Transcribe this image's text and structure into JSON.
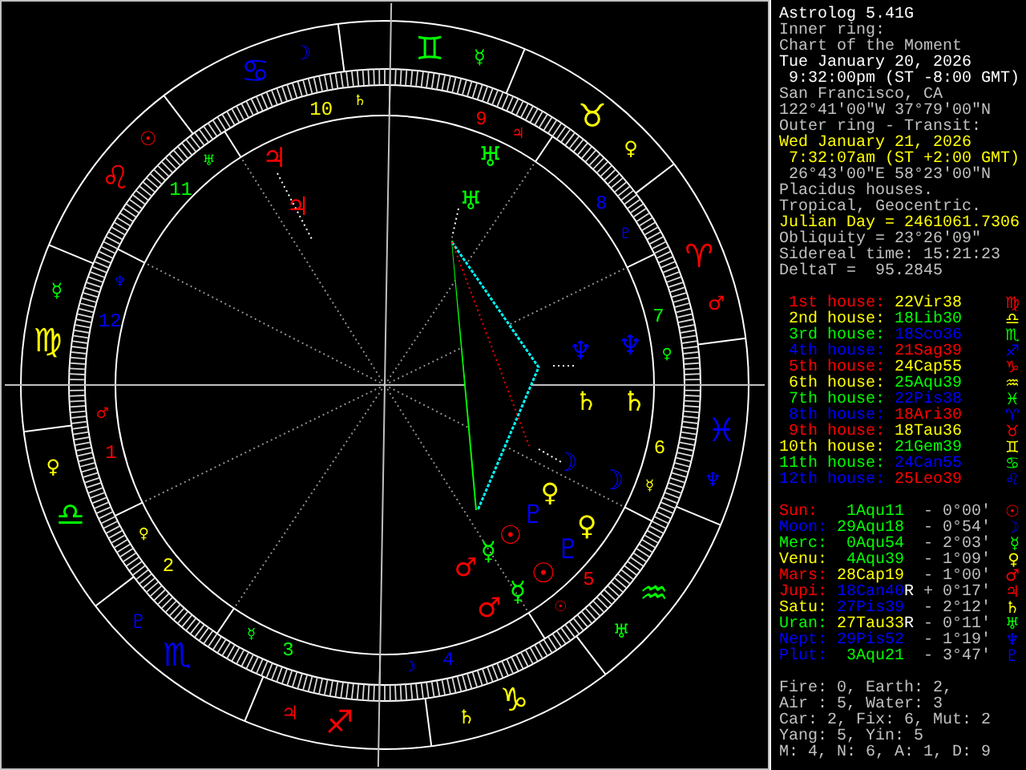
{
  "info": [
    {
      "text": "Astrolog 5.41G",
      "color": "#ffffff"
    },
    {
      "text": "Inner ring:",
      "color": "#c0c0c0"
    },
    {
      "text": "Chart of the Moment",
      "color": "#c0c0c0"
    },
    {
      "text": "Tue January 20, 2026",
      "color": "#ffffff"
    },
    {
      "text": " 9:32:00pm (ST -8:00 GMT)",
      "color": "#ffffff"
    },
    {
      "text": "San Francisco, CA",
      "color": "#c0c0c0"
    },
    {
      "text": "122°41'00\"W 37°79'00\"N",
      "color": "#c0c0c0"
    },
    {
      "text": "Outer ring - Transit:",
      "color": "#c0c0c0"
    },
    {
      "text": "Wed January 21, 2026",
      "color": "#ffff00"
    },
    {
      "text": " 7:32:07am (ST +2:00 GMT)",
      "color": "#ffff00"
    },
    {
      "text": " 26°43'00\"E 58°23'00\"N",
      "color": "#c0c0c0"
    },
    {
      "text": "Placidus houses.",
      "color": "#c0c0c0"
    },
    {
      "text": "Tropical, Geocentric.",
      "color": "#c0c0c0"
    },
    {
      "text": "Julian Day = 2461061.7306",
      "color": "#ffff00"
    },
    {
      "text": "Obliquity = 23°26'09\"",
      "color": "#c0c0c0"
    },
    {
      "text": "Sidereal time: 15:21:23",
      "color": "#c0c0c0"
    },
    {
      "text": "DeltaT =  95.2845",
      "color": "#c0c0c0"
    }
  ],
  "houses": [
    {
      "label": {
        "text": "1st house:",
        "color": "#ff0000"
      },
      "cusp": {
        "text": "22Vir38",
        "color": "#ffff00"
      },
      "glyph": {
        "text": "♍",
        "color": "#ff0000"
      }
    },
    {
      "label": {
        "text": "2nd house:",
        "color": "#ffff00"
      },
      "cusp": {
        "text": "18Lib30",
        "color": "#00ff00"
      },
      "glyph": {
        "text": "♎",
        "color": "#ffff00"
      }
    },
    {
      "label": {
        "text": "3rd house:",
        "color": "#00ff00"
      },
      "cusp": {
        "text": "18Sco36",
        "color": "#0000ff"
      },
      "glyph": {
        "text": "♏",
        "color": "#00ff00"
      }
    },
    {
      "label": {
        "text": "4th house:",
        "color": "#0000ff"
      },
      "cusp": {
        "text": "21Sag39",
        "color": "#ff0000"
      },
      "glyph": {
        "text": "♐",
        "color": "#0000ff"
      }
    },
    {
      "label": {
        "text": "5th house:",
        "color": "#ff0000"
      },
      "cusp": {
        "text": "24Cap55",
        "color": "#ffff00"
      },
      "glyph": {
        "text": "♑",
        "color": "#ff0000"
      }
    },
    {
      "label": {
        "text": "6th house:",
        "color": "#ffff00"
      },
      "cusp": {
        "text": "25Aqu39",
        "color": "#00ff00"
      },
      "glyph": {
        "text": "♒",
        "color": "#ffff00"
      }
    },
    {
      "label": {
        "text": "7th house:",
        "color": "#00ff00"
      },
      "cusp": {
        "text": "22Pis38",
        "color": "#0000ff"
      },
      "glyph": {
        "text": "♓",
        "color": "#00ff00"
      }
    },
    {
      "label": {
        "text": "8th house:",
        "color": "#0000ff"
      },
      "cusp": {
        "text": "18Ari30",
        "color": "#ff0000"
      },
      "glyph": {
        "text": "♈",
        "color": "#0000ff"
      }
    },
    {
      "label": {
        "text": "9th house:",
        "color": "#ff0000"
      },
      "cusp": {
        "text": "18Tau36",
        "color": "#ffff00"
      },
      "glyph": {
        "text": "♉",
        "color": "#ff0000"
      }
    },
    {
      "label": {
        "text": "10th house:",
        "color": "#ffff00"
      },
      "cusp": {
        "text": "21Gem39",
        "color": "#00ff00"
      },
      "glyph": {
        "text": "♊",
        "color": "#ffff00"
      }
    },
    {
      "label": {
        "text": "11th house:",
        "color": "#00ff00"
      },
      "cusp": {
        "text": "24Can55",
        "color": "#0000ff"
      },
      "glyph": {
        "text": "♋",
        "color": "#00ff00"
      }
    },
    {
      "label": {
        "text": "12th house:",
        "color": "#0000ff"
      },
      "cusp": {
        "text": "25Leo39",
        "color": "#ff0000"
      },
      "glyph": {
        "text": "♌",
        "color": "#0000ff"
      }
    }
  ],
  "planets": [
    {
      "name": "Sun:",
      "color": "#ff0000",
      "position": {
        "text": "1Aqu11",
        "color": "#00ff00"
      },
      "aspect": "- 0°00'",
      "glyph": "☉"
    },
    {
      "name": "Moon:",
      "color": "#0000ff",
      "position": {
        "text": "29Aqu18",
        "color": "#00ff00"
      },
      "aspect": "- 0°54'",
      "glyph": "☽"
    },
    {
      "name": "Merc:",
      "color": "#00ff00",
      "position": {
        "text": "0Aqu54",
        "color": "#00ff00"
      },
      "aspect": "- 2°03'",
      "glyph": "☿"
    },
    {
      "name": "Venu:",
      "color": "#ffff00",
      "position": {
        "text": "4Aqu39",
        "color": "#00ff00"
      },
      "aspect": "- 1°09'",
      "glyph": "♀"
    },
    {
      "name": "Mars:",
      "color": "#ff0000",
      "position": {
        "text": "28Cap19",
        "color": "#ffff00"
      },
      "aspect": "- 1°00'",
      "glyph": "♂"
    },
    {
      "name": "Jupi:",
      "color": "#ff0000",
      "position": {
        "text": "18Can40",
        "color": "#0000ff"
      },
      "retrograde_mark": "R",
      "aspect": "+ 0°17'",
      "glyph": "♃"
    },
    {
      "name": "Satu:",
      "color": "#ffff00",
      "position": {
        "text": "27Pis39",
        "color": "#0000ff"
      },
      "aspect": "- 2°12'",
      "glyph": "♄"
    },
    {
      "name": "Uran:",
      "color": "#00ff00",
      "position": {
        "text": "27Tau33",
        "color": "#ffff00"
      },
      "retrograde_mark": "R",
      "aspect": "- 0°11'",
      "glyph": "♅"
    },
    {
      "name": "Nept:",
      "color": "#0000ff",
      "position": {
        "text": "29Pis52",
        "color": "#0000ff"
      },
      "aspect": "- 1°19'",
      "glyph": "♆"
    },
    {
      "name": "Plut:",
      "color": "#0000ff",
      "position": {
        "text": "3Aqu21",
        "color": "#00ff00"
      },
      "aspect": "- 3°47'",
      "glyph": "♇"
    }
  ],
  "summary": [
    "Fire: 0, Earth: 2,",
    "Air : 5, Water: 3",
    "Car: 2, Fix: 6, Mut: 2",
    "Yang: 5, Yin: 5",
    "M: 4, N: 6, A: 1, D: 9"
  ],
  "wheel": {
    "signs": [
      {
        "glyph": "♈",
        "color": "#ff0000",
        "ruler": {
          "text": "♂",
          "color": "#ff0000"
        }
      },
      {
        "glyph": "♉",
        "color": "#ffff00",
        "ruler": {
          "text": "♀",
          "color": "#ffff00"
        }
      },
      {
        "glyph": "♊",
        "color": "#00ff00",
        "ruler": {
          "text": "☿",
          "color": "#00ff00"
        }
      },
      {
        "glyph": "♋",
        "color": "#0000ff",
        "ruler": {
          "text": "☽",
          "color": "#0000ff"
        }
      },
      {
        "glyph": "♌",
        "color": "#ff0000",
        "ruler": {
          "text": "☉",
          "color": "#ff0000"
        }
      },
      {
        "glyph": "♍",
        "color": "#ffff00",
        "ruler": {
          "text": "☿",
          "color": "#00ff00"
        }
      },
      {
        "glyph": "♎",
        "color": "#00ff00",
        "ruler": {
          "text": "♀",
          "color": "#ffff00"
        }
      },
      {
        "glyph": "♏",
        "color": "#0000ff",
        "ruler": {
          "text": "♇",
          "color": "#0000ff"
        }
      },
      {
        "glyph": "♐",
        "color": "#ff0000",
        "ruler": {
          "text": "♃",
          "color": "#ff0000"
        }
      },
      {
        "glyph": "♑",
        "color": "#ffff00",
        "ruler": {
          "text": "♄",
          "color": "#ffff00"
        }
      },
      {
        "glyph": "♒",
        "color": "#00ff00",
        "ruler": {
          "text": "♅",
          "color": "#00ff00"
        }
      },
      {
        "glyph": "♓",
        "color": "#0000ff",
        "ruler": {
          "text": "♆",
          "color": "#0000ff"
        }
      }
    ],
    "houses": [
      {
        "number": "1",
        "color": "#ff0000",
        "ruler": "♂"
      },
      {
        "number": "2",
        "color": "#ffff00",
        "ruler": "♀"
      },
      {
        "number": "3",
        "color": "#00ff00",
        "ruler": "☿"
      },
      {
        "number": "4",
        "color": "#0000ff",
        "ruler": "☽"
      },
      {
        "number": "5",
        "color": "#ff0000",
        "ruler": "☉"
      },
      {
        "number": "6",
        "color": "#ffff00",
        "ruler": "☿"
      },
      {
        "number": "7",
        "color": "#00ff00",
        "ruler": "♀"
      },
      {
        "number": "8",
        "color": "#0000ff",
        "ruler": "♇"
      },
      {
        "number": "9",
        "color": "#ff0000",
        "ruler": "♃"
      },
      {
        "number": "10",
        "color": "#ffff00",
        "ruler": "♄"
      },
      {
        "number": "11",
        "color": "#00ff00",
        "ruler": "♅"
      },
      {
        "number": "12",
        "color": "#0000ff",
        "ruler": "♆"
      }
    ],
    "inner_planets": [
      {
        "glyph": "☉",
        "color": "#ff0000"
      },
      {
        "glyph": "☽",
        "color": "#0000ff"
      },
      {
        "glyph": "☿",
        "color": "#00ff00"
      },
      {
        "glyph": "♀",
        "color": "#ffff00"
      },
      {
        "glyph": "♂",
        "color": "#ff0000"
      },
      {
        "glyph": "♃",
        "color": "#ff0000"
      },
      {
        "glyph": "♄",
        "color": "#ffff00"
      },
      {
        "glyph": "♅",
        "color": "#00ff00"
      },
      {
        "glyph": "♆",
        "color": "#0000ff"
      },
      {
        "glyph": "♇",
        "color": "#0000ff"
      }
    ],
    "outer_planets": [
      {
        "glyph": "☉",
        "color": "#ff0000"
      },
      {
        "glyph": "☽",
        "color": "#0000ff"
      },
      {
        "glyph": "☿",
        "color": "#00ff00"
      },
      {
        "glyph": "♀",
        "color": "#ffff00"
      },
      {
        "glyph": "♂",
        "color": "#ff0000"
      },
      {
        "glyph": "♃",
        "color": "#ff0000"
      },
      {
        "glyph": "♄",
        "color": "#ffff00"
      },
      {
        "glyph": "♅",
        "color": "#00ff00"
      },
      {
        "glyph": "♆",
        "color": "#0000ff"
      },
      {
        "glyph": "♇",
        "color": "#0000ff"
      }
    ]
  }
}
